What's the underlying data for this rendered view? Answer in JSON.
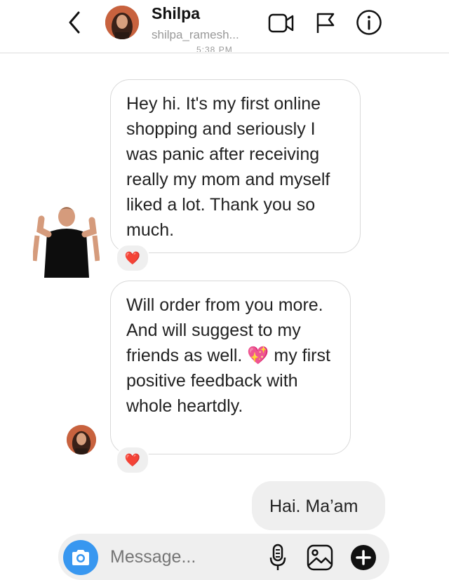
{
  "header": {
    "name": "Shilpa",
    "handle": "shilpa_ramesh...",
    "timestamp": "5:38 PM",
    "icons": [
      "back-chevron-icon",
      "video-call-icon",
      "flag-icon",
      "info-icon"
    ]
  },
  "messages": [
    {
      "from": "contact",
      "text": "Hey hi.  It's my first online shopping and seriously I was panic after receiving really my mom and myself liked a lot. Thank you so much.",
      "reaction": "❤️"
    },
    {
      "from": "contact",
      "text_before_emoji": "Will order from you more. And will suggest to my friends as well.",
      "emoji": "💖",
      "text_after_emoji": "my first positive feedback with whole heartdly.",
      "reaction": "❤️"
    },
    {
      "from": "me",
      "text": "Hai. Ma’am"
    }
  ],
  "composer": {
    "placeholder": "Message...",
    "icons": [
      "camera-icon",
      "microphone-icon",
      "gallery-icon",
      "plus-icon"
    ]
  },
  "colors": {
    "camera_button": "#3897f0",
    "bubble_border": "#d9d9d9",
    "my_bubble": "#efefef",
    "reaction": "#e0245e"
  }
}
